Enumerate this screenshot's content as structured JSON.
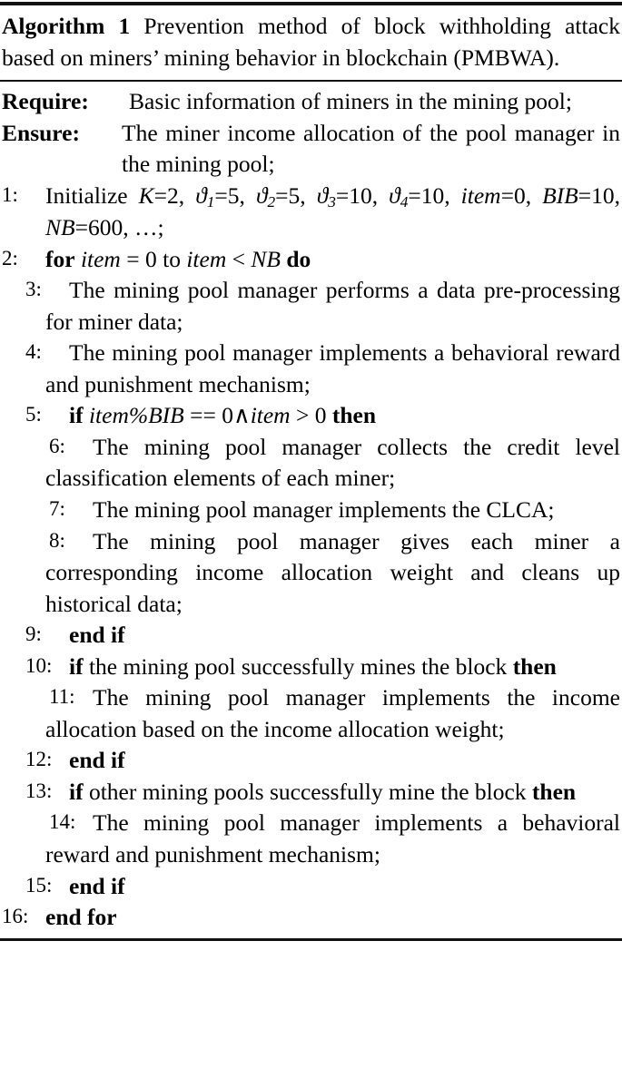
{
  "algorithm": {
    "label": "Algorithm 1",
    "title": "Prevention method of block withholding attack based on miners’ mining behavior in blockchain (PMBWA).",
    "require": {
      "label": "Require:",
      "text": "Basic information of miners in the mining pool;"
    },
    "ensure": {
      "label": "Ensure:",
      "text": "The miner income allocation of the pool manager in the mining pool;"
    },
    "steps": [
      {
        "num": "1:",
        "text": "Initialize K=2, ϑ1=5, ϑ2=5, ϑ3=10, ϑ4=10, item=0, BIB=10, NB=600, …;"
      },
      {
        "num": "2:",
        "text": "for item = 0 to item < NB do"
      },
      {
        "num": "3:",
        "text": "The mining pool manager performs a data pre-processing for miner data;"
      },
      {
        "num": "4:",
        "text": "The mining pool manager implements a behavioral reward and punishment mechanism;"
      },
      {
        "num": "5:",
        "text": "if item%BIB == 0∧item > 0 then"
      },
      {
        "num": "6:",
        "text": "The mining pool manager collects the credit level classification elements of each miner;"
      },
      {
        "num": "7:",
        "text": "The mining pool manager implements the CLCA;"
      },
      {
        "num": "8:",
        "text": "The mining pool manager gives each miner a corresponding income allocation weight and cleans up historical data;"
      },
      {
        "num": "9:",
        "text": "end if"
      },
      {
        "num": "10:",
        "text": "if the mining pool successfully mines the block then"
      },
      {
        "num": "11:",
        "text": "The mining pool manager implements the income allocation based on the income allocation weight;"
      },
      {
        "num": "12:",
        "text": "end if"
      },
      {
        "num": "13:",
        "text": "if other mining pools successfully mine the block then"
      },
      {
        "num": "14:",
        "text": "The mining pool manager implements a behavioral reward and punishment mechanism;"
      },
      {
        "num": "15:",
        "text": "end if"
      },
      {
        "num": "16:",
        "text": "end for"
      }
    ]
  }
}
